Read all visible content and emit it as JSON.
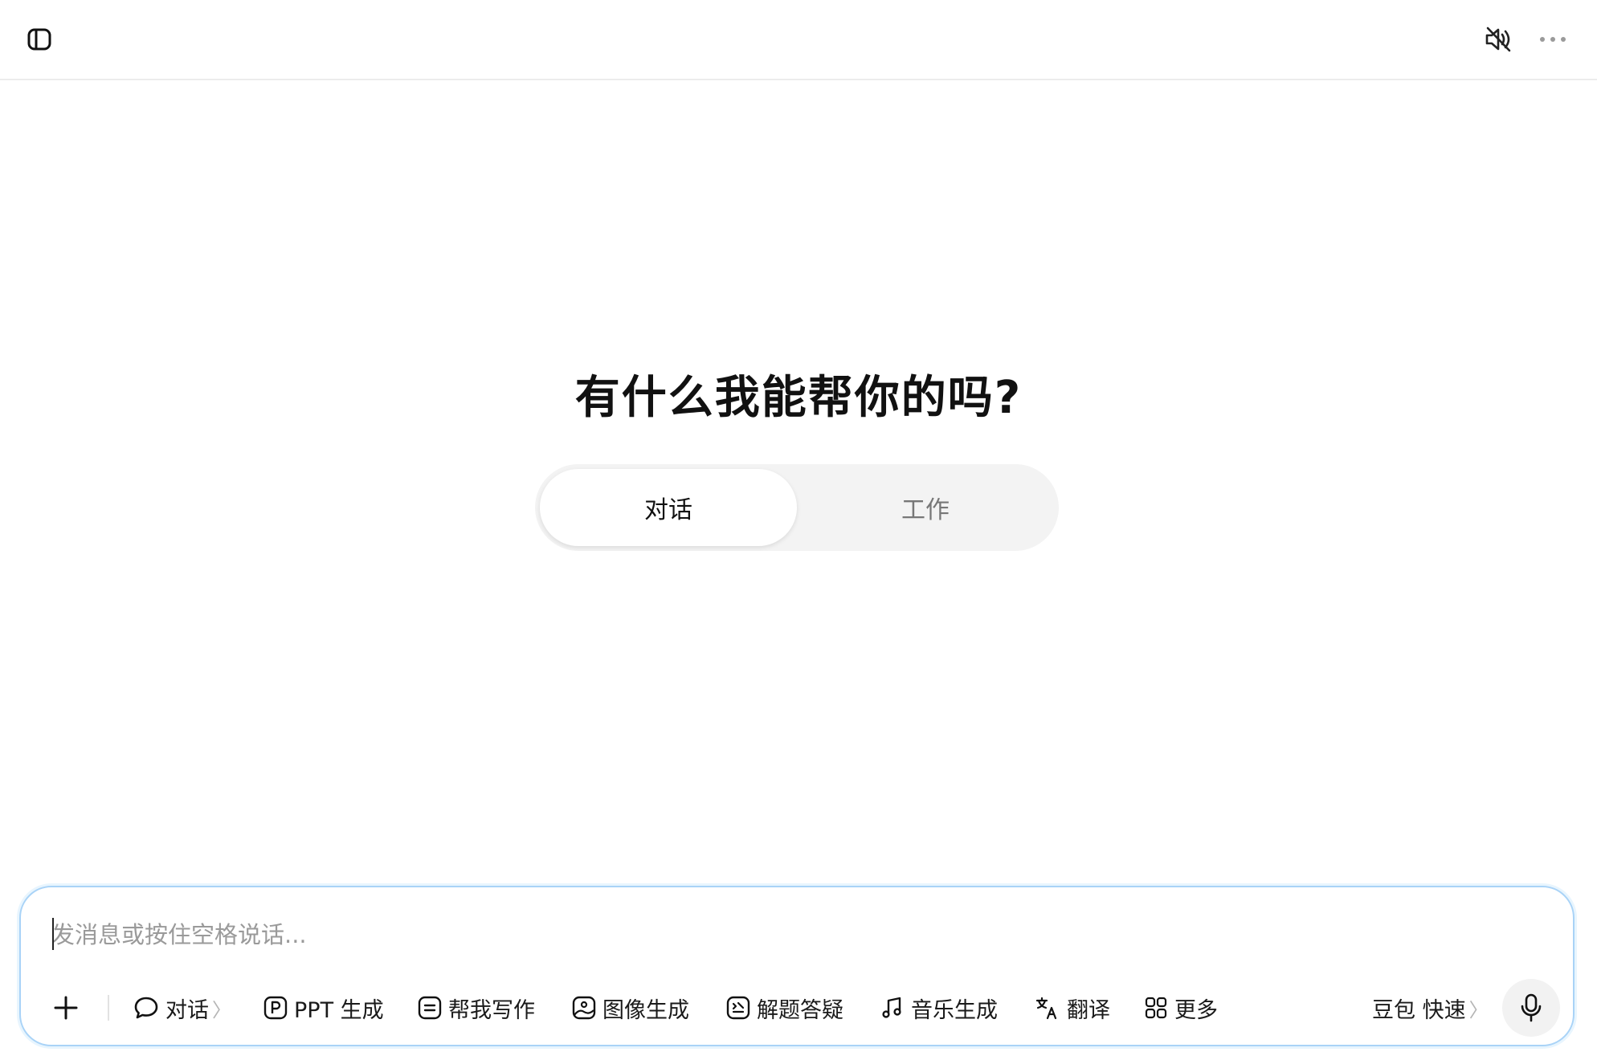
{
  "header": {
    "sidebar_icon": "sidebar-toggle-icon",
    "mute_icon": "speaker-muted-icon",
    "more_icon": "more-dots-icon"
  },
  "main": {
    "headline": "有什么我能帮你的吗?",
    "modes": [
      {
        "label": "对话",
        "active": true
      },
      {
        "label": "工作",
        "active": false
      }
    ]
  },
  "composer": {
    "placeholder": "发消息或按住空格说话...",
    "value": "",
    "tools": [
      {
        "label": "对话",
        "icon": "chat-bubble-icon",
        "chevron": "〉"
      },
      {
        "label": "PPT 生成",
        "icon": "ppt-icon"
      },
      {
        "label": "帮我写作",
        "icon": "writing-icon"
      },
      {
        "label": "图像生成",
        "icon": "image-icon"
      },
      {
        "label": "解题答疑",
        "icon": "solve-icon"
      },
      {
        "label": "音乐生成",
        "icon": "music-icon"
      },
      {
        "label": "翻译",
        "icon": "translate-icon"
      },
      {
        "label": "更多",
        "icon": "grid-icon"
      }
    ],
    "model": {
      "label": "豆包 快速",
      "chevron": "〉"
    },
    "mic_icon": "microphone-icon"
  },
  "colors": {
    "accent_border": "#a9d3f7",
    "switch_bg": "#f3f3f3",
    "inactive_text": "#777777"
  }
}
